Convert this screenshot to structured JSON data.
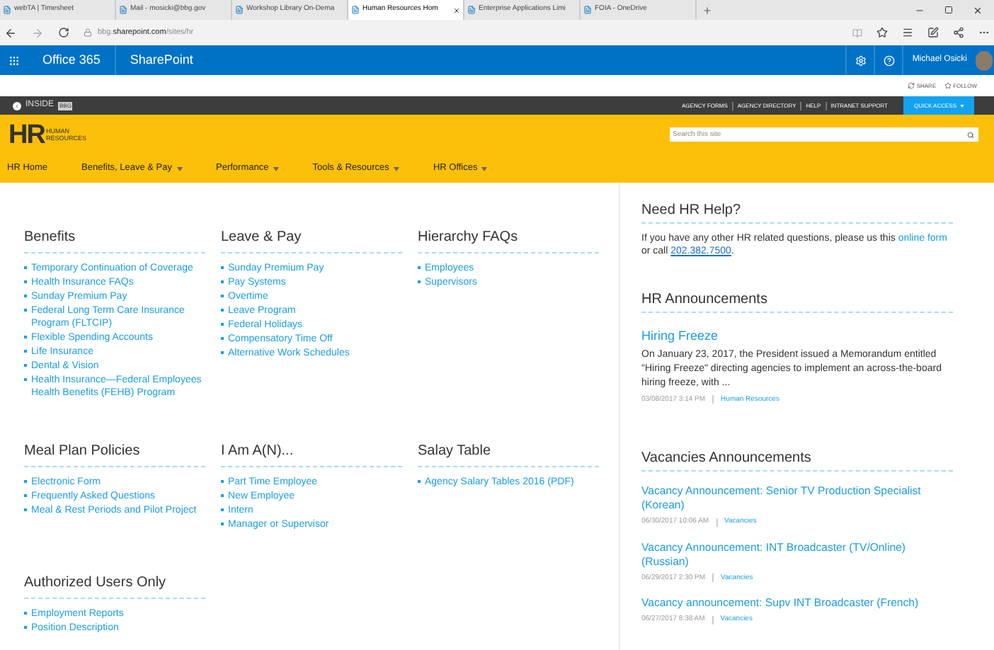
{
  "browser_tabs": [
    {
      "label": "webTA | Timesheet",
      "selected": false
    },
    {
      "label": "Mail - mosicki@bbg.gov",
      "selected": false
    },
    {
      "label": "Workshop Library On-Dema",
      "selected": false
    },
    {
      "label": "Human Resources Hom",
      "selected": true
    },
    {
      "label": "Enterprise Applications Limi",
      "selected": false
    },
    {
      "label": "FOIA - OneDrive",
      "selected": false
    }
  ],
  "address": {
    "prefix": "bbg.",
    "domain": "sharepoint.com",
    "path": "/sites/hr"
  },
  "suite_bar": {
    "app": "Office 365",
    "product": "SharePoint",
    "user": "Michael Osicki"
  },
  "page_actions": [
    "SHARE",
    "FOLLOW"
  ],
  "inside_bar": {
    "brand": "INSIDE",
    "badge": "BBG",
    "links": [
      "AGENCY FORMS",
      "AGENCY DIRECTORY",
      "HELP",
      "INTRANET SUPPORT"
    ],
    "quick_access": "QUICK ACCESS"
  },
  "hr_logo": {
    "mark": "HR",
    "line1": "HUMAN",
    "line2": "RESOURCES"
  },
  "search": {
    "placeholder": "Search this site"
  },
  "nav": [
    {
      "label": "HR Home",
      "has_menu": false
    },
    {
      "label": "Benefits, Leave & Pay",
      "has_menu": true
    },
    {
      "label": "Performance",
      "has_menu": true
    },
    {
      "label": "Tools & Resources",
      "has_menu": true
    },
    {
      "label": "HR Offices",
      "has_menu": true
    }
  ],
  "section_rows": [
    [
      {
        "title": "Benefits",
        "links": [
          "Temporary Continuation of Coverage",
          "Health Insurance FAQs",
          "Sunday Premium Pay",
          "Federal Long Term Care Insurance Program (FLTCIP)",
          "Flexible Spending Accounts",
          "Life Insurance",
          "Dental & Vision",
          "Health Insurance—Federal Employees Health Benefits (FEHB) Program"
        ]
      },
      {
        "title": "Leave & Pay",
        "links": [
          "Sunday Premium Pay",
          "Pay Systems",
          "Overtime",
          "Leave Program",
          "Federal Holidays",
          "Compensatory Time Off",
          "Alternative Work Schedules"
        ]
      },
      {
        "title": "Hierarchy FAQs",
        "links": [
          "Employees",
          "Supervisors"
        ]
      }
    ],
    [
      {
        "title": "Meal Plan Policies",
        "links": [
          "Electronic Form",
          "Frequently Asked Questions",
          "Meal & Rest Periods and Pilot Project"
        ]
      },
      {
        "title": "I Am A(N)...",
        "links": [
          "Part Time Employee",
          "New Employee",
          "Intern",
          "Manager or Supervisor"
        ]
      },
      {
        "title": "Salay Table",
        "links": [
          "Agency Salary Tables 2016 (PDF)"
        ]
      }
    ],
    [
      {
        "title": "Authorized Users Only",
        "links": [
          "Employment Reports",
          "Position Description"
        ]
      }
    ]
  ],
  "help": {
    "title": "Need HR Help?",
    "text_before": "If you have any other HR related questions, please us this ",
    "link": "online form",
    "text_middle": " or call ",
    "phone": "202.382.7500",
    "text_after": "."
  },
  "announcements": {
    "title": "HR Announcements",
    "items": [
      {
        "title": "Hiring Freeze",
        "body": "On January 23, 2017, the President issued a Memorandum entitled \"Hiring Freeze\" directing agencies to implement an across-the-board hiring freeze, with ...",
        "date": "03/08/2017 3:14 PM",
        "category": "Human Resources"
      }
    ]
  },
  "vacancies": {
    "title": "Vacancies Announcements",
    "items": [
      {
        "title": "Vacancy Announcement: Senior TV Production Specialist (Korean)",
        "date": "06/30/2017 10:06 AM",
        "category": "Vacancies"
      },
      {
        "title": "Vacancy Announcement: INT Broadcaster (TV/Online) (Russian)",
        "date": "06/29/2017 2:30 PM",
        "category": "Vacancies"
      },
      {
        "title": "Vacancy announcement: Supv INT Broadcaster (French)",
        "date": "06/27/2017 8:38 AM",
        "category": "Vacancies"
      }
    ]
  }
}
